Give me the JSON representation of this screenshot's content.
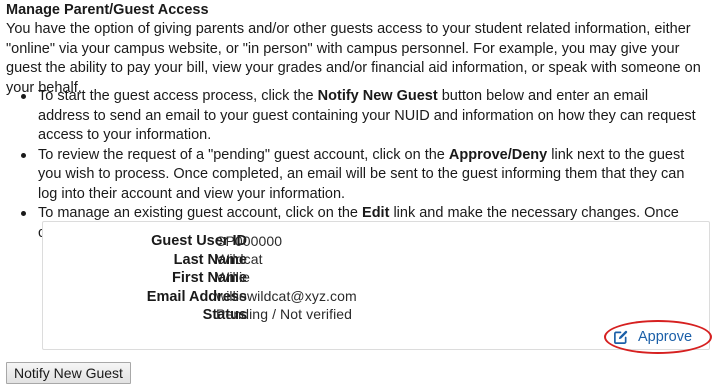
{
  "title": "Manage Parent/Guest Access",
  "intro": "You have the option of giving parents and/or other guests access to your student related information, either \"online\" via your campus website, or \"in person\" with campus personnel. For example, you may give your guest the ability to pay your bill, view your grades and/or financial aid information, or speak with someone on your behalf.",
  "bullets": [
    {
      "pre": "To start the guest access process, click the ",
      "bold": "Notify New Guest",
      "post": " button below and enter an email address to send an email to your guest containing your NUID and information on how they can request access to your information."
    },
    {
      "pre": "To review the request of a \"pending\" guest account, click on the ",
      "bold": "Approve/Deny",
      "post": " link next to the guest you wish to process. Once completed, an email will be sent to the guest informing them that they can log into their account and view your information."
    },
    {
      "pre": "To manage an existing guest account, click on the ",
      "bold": "Edit",
      "post": " link and make the necessary changes. Once completed, an email will be sent to the guest informing them that their access has been changed."
    }
  ],
  "guest": {
    "fields": [
      {
        "label": "Guest User ID",
        "value": "SP000000"
      },
      {
        "label": "Last Name",
        "value": "Wildcat"
      },
      {
        "label": "First Name",
        "value": "Willie"
      },
      {
        "label": "Email Address",
        "value": "williewildcat@xyz.com"
      },
      {
        "label": "Status",
        "value": "Pending / Not verified"
      }
    ],
    "approve_label": "Approve",
    "approve_icon": "edit-square-icon"
  },
  "notify_button_label": "Notify New Guest",
  "colors": {
    "link": "#1b5fa8",
    "highlight": "#d62020"
  }
}
